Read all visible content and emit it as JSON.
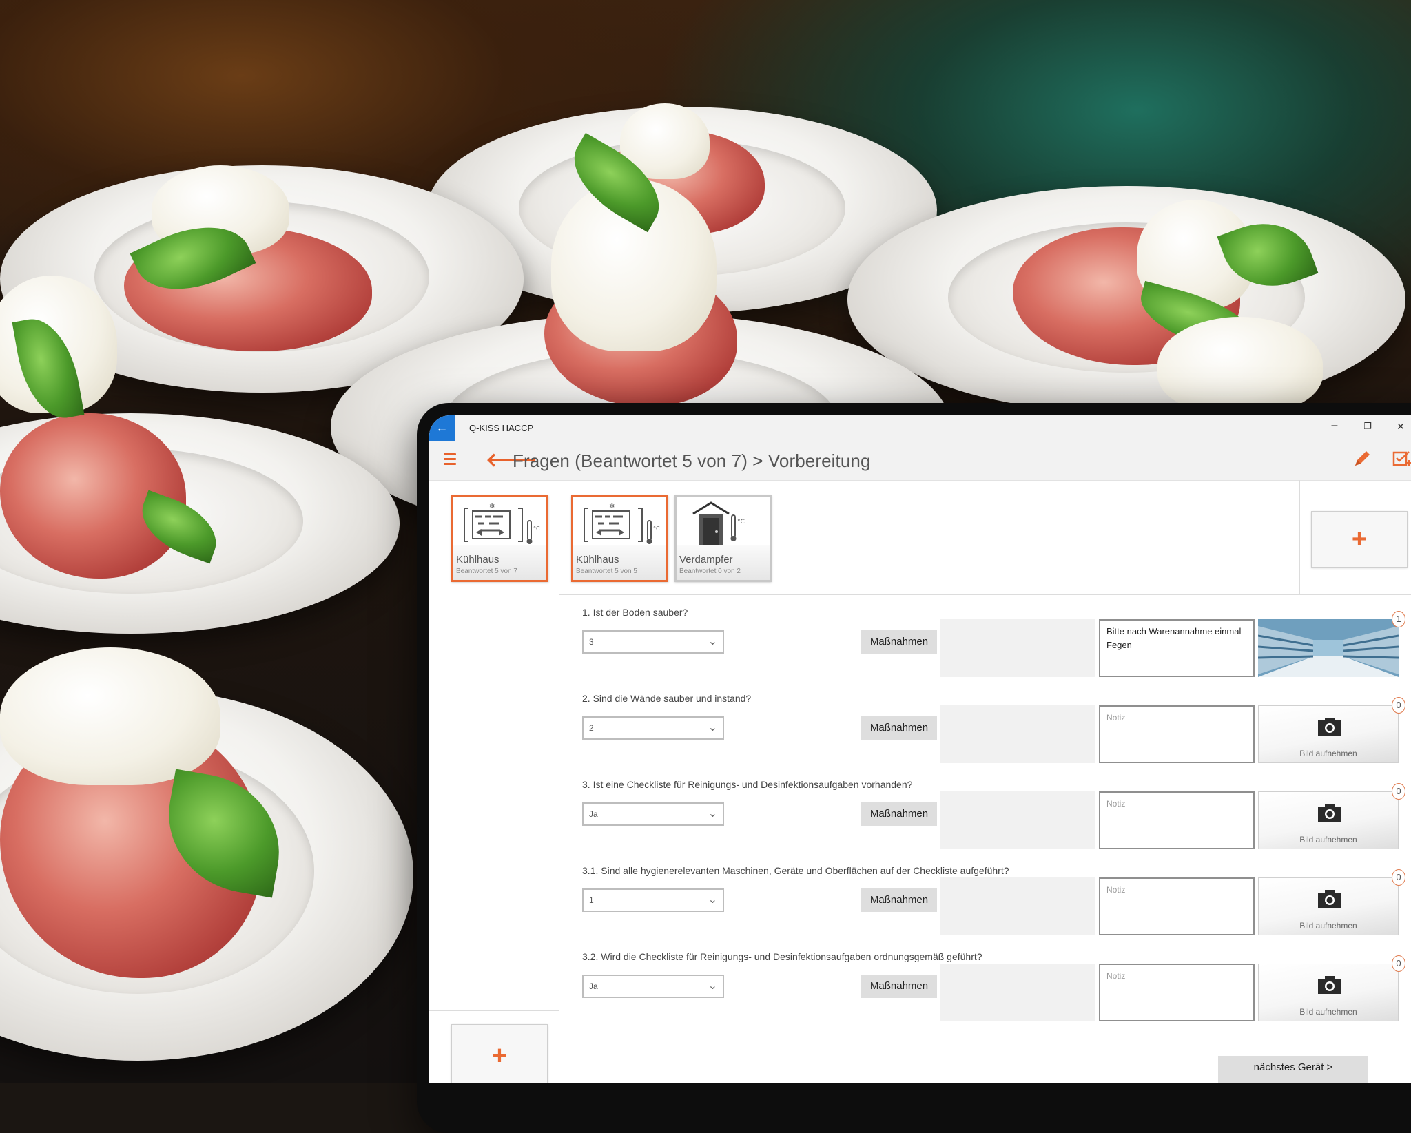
{
  "window": {
    "app_title": "Q-KISS HACCP",
    "back_glyph": "←",
    "minimize_glyph": "–",
    "restore_glyph": "❐",
    "close_glyph": "✕"
  },
  "header": {
    "breadcrumb": "Fragen (Beantwortet 5 von 7) > Vorbereitung",
    "back_glyph": "🡐",
    "edit_icon": "pencil-icon",
    "check_icon": "checklist-icon"
  },
  "left_panel": {
    "tile": {
      "name": "Kühlhaus",
      "subtitle": "Beantwortet 5 von 7"
    },
    "add_glyph": "+"
  },
  "devices": [
    {
      "name": "Kühlhaus",
      "subtitle": "Beantwortet 5 von 5"
    },
    {
      "name": "Verdampfer",
      "subtitle": "Beantwortet 0 von 2"
    }
  ],
  "add_device_glyph": "+",
  "questions": [
    {
      "label": "1. Ist der Boden sauber?",
      "value": "3",
      "button": "Maßnahmen",
      "note": "Bitte nach Warenannahme einmal Fegen",
      "note_placeholder": "Notiz",
      "photo_caption": "",
      "count": "1"
    },
    {
      "label": "2. Sind die Wände sauber und instand?",
      "value": "2",
      "button": "Maßnahmen",
      "note": "",
      "note_placeholder": "Notiz",
      "photo_caption": "Bild aufnehmen",
      "count": "0"
    },
    {
      "label": "3. Ist eine Checkliste für Reinigungs- und Desinfektionsaufgaben vorhanden?",
      "value": "Ja",
      "button": "Maßnahmen",
      "note": "",
      "note_placeholder": "Notiz",
      "photo_caption": "Bild aufnehmen",
      "count": "0"
    },
    {
      "label": "3.1. Sind alle hygienerelevanten Maschinen, Geräte und Oberflächen auf der Checkliste aufgeführt?",
      "value": "1",
      "button": "Maßnahmen",
      "note": "",
      "note_placeholder": "Notiz",
      "photo_caption": "Bild aufnehmen",
      "count": "0"
    },
    {
      "label": "3.2. Wird die Checkliste für Reinigungs- und Desinfektionsaufgaben ordnungsgemäß geführt?",
      "value": "Ja",
      "button": "Maßnahmen",
      "note": "",
      "note_placeholder": "Notiz",
      "photo_caption": "Bild aufnehmen",
      "count": "0"
    }
  ],
  "select_chevron": "⌄",
  "next_button": "nächstes Gerät >",
  "colors": {
    "accent": "#ea6a33",
    "titlebar_back": "#1e78d6",
    "chrome": "#f2f2f2"
  }
}
